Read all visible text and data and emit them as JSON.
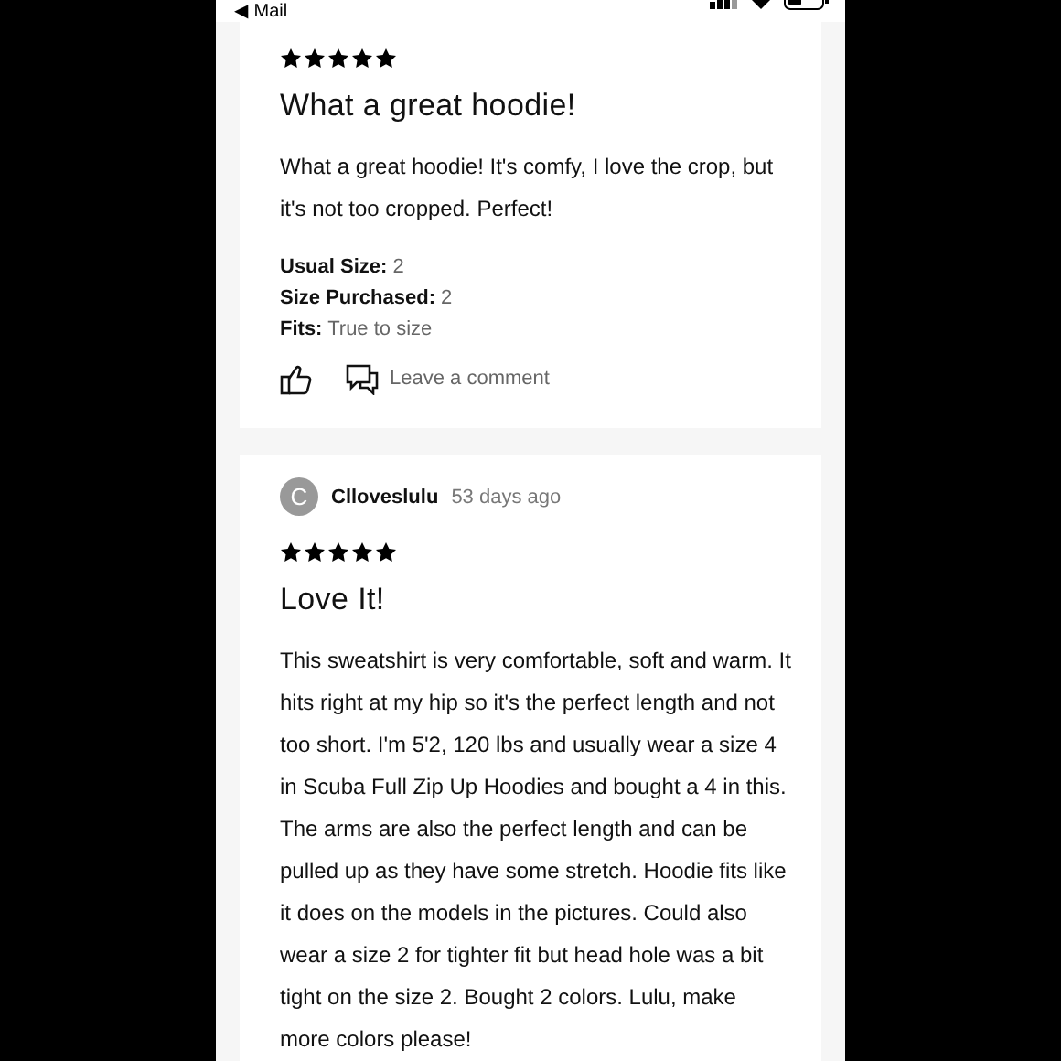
{
  "status_bar": {
    "back_label": "◀ Mail"
  },
  "reviews": [
    {
      "stars": 5,
      "title": "What a great hoodie!",
      "body": "What a great hoodie! It's comfy, I love the crop, but it's not too cropped. Perfect!",
      "details": [
        {
          "label": "Usual Size:",
          "value": "2"
        },
        {
          "label": "Size Purchased:",
          "value": "2"
        },
        {
          "label": "Fits:",
          "value": "True to size"
        }
      ],
      "comment_label": "Leave a comment"
    },
    {
      "author": {
        "initial": "C",
        "name": "Clloveslulu",
        "time": "53 days ago"
      },
      "stars": 5,
      "title": "Love It!",
      "body": "This sweatshirt is very comfortable, soft and warm. It hits right at my hip so it's the perfect length and not too short. I'm 5'2, 120 lbs and usually wear a size 4 in Scuba Full Zip Up Hoodies and bought a 4 in this. The arms are also the perfect length and can be pulled up as they have some stretch. Hoodie fits like it does on the models in the pictures. Could also wear a size 2 for tighter fit but head hole was a bit tight on the size 2. Bought 2 colors. Lulu, make more colors please!"
    }
  ]
}
